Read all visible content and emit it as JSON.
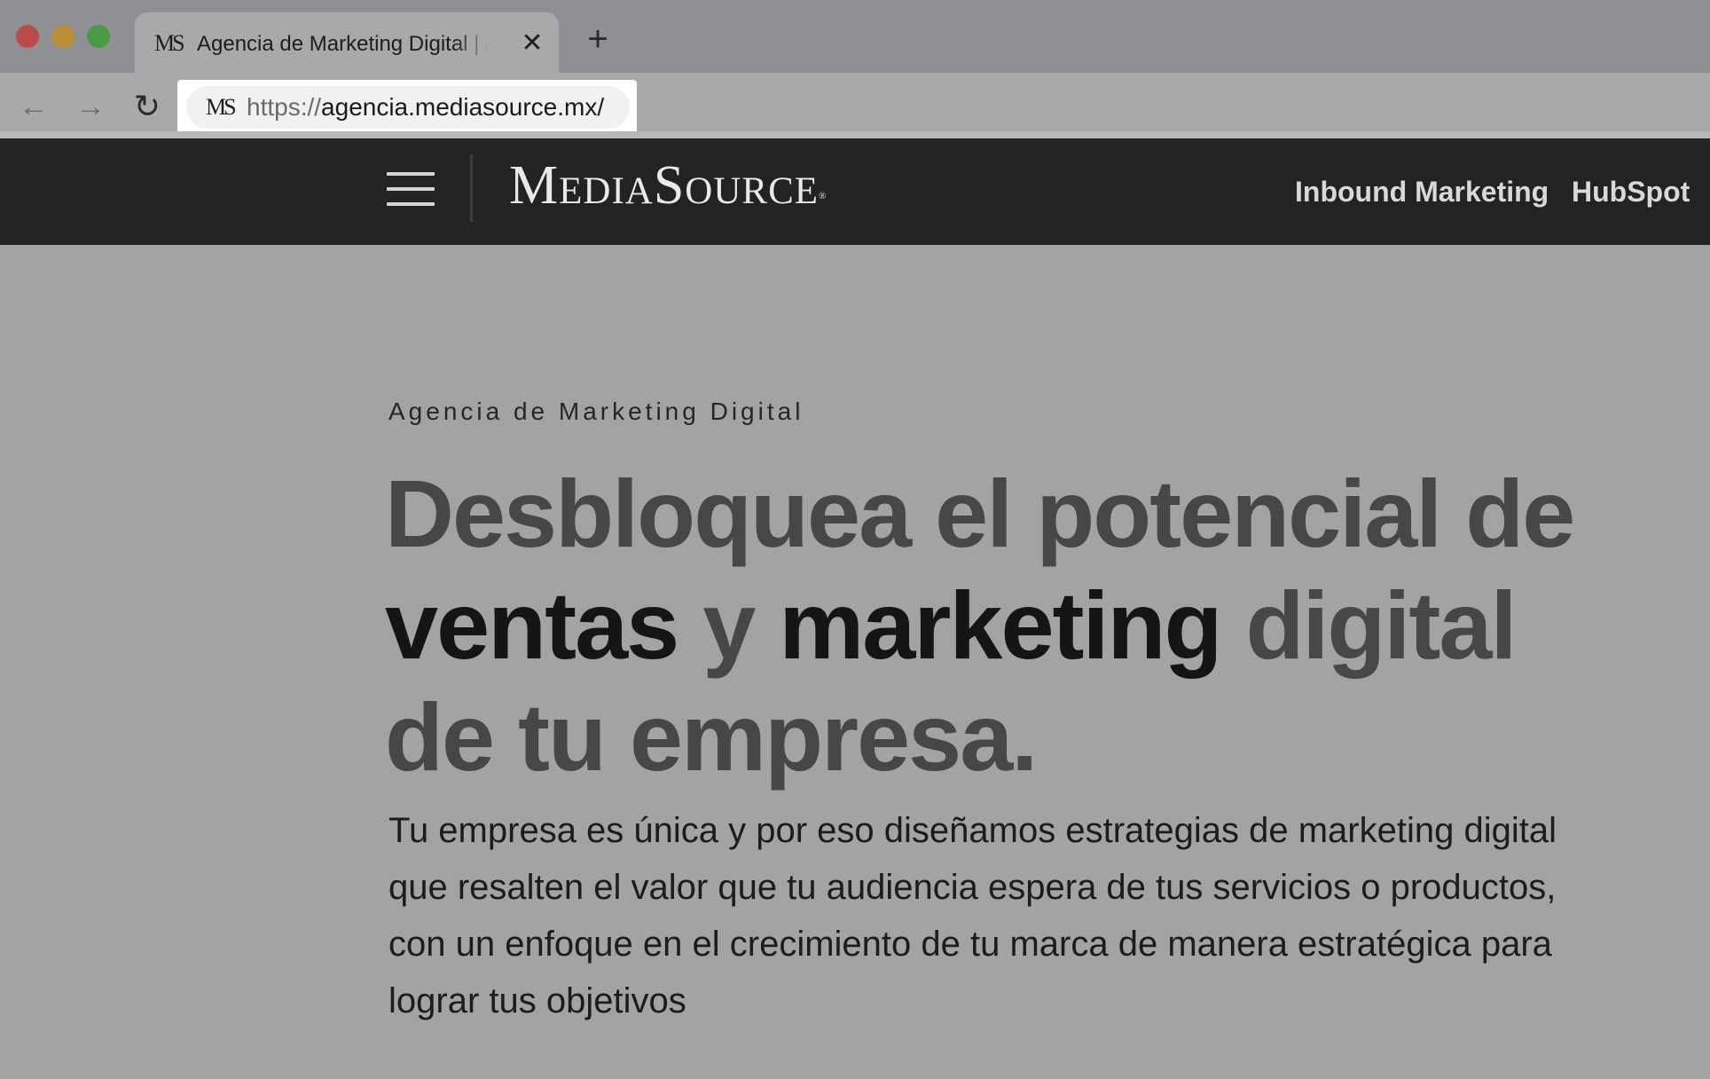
{
  "browser": {
    "tab": {
      "favicon_text": "MS",
      "title": "Agencia de Marketing Digital | Agencia MediaSource",
      "close_glyph": "✕"
    },
    "new_tab_glyph": "+",
    "nav": {
      "back_glyph": "←",
      "forward_glyph": "→",
      "reload_glyph": "↻"
    },
    "address_bar": {
      "favicon_text": "MS",
      "scheme": "https://",
      "host": "agencia.mediasource.mx/"
    }
  },
  "site": {
    "logo": "MediaSource",
    "logo_mark": "®",
    "nav_links": [
      "Inbound Marketing",
      "HubSpot"
    ]
  },
  "hero": {
    "eyebrow": "Agencia de Marketing Digital",
    "headline": {
      "part1": "Desbloquea el potencial de ",
      "highlight1": "ventas",
      "part2": " y ",
      "highlight2": "marketing",
      "part3": " digital de tu empresa."
    },
    "description": "Tu empresa es única y por eso diseñamos estrategias de marketing digital que resalten el valor que tu audiencia espera de tus servicios o productos, con un enfoque en el crecimiento de tu marca de manera estratégica para lograr tus objetivos"
  },
  "colors": {
    "header_bg": "#232324",
    "page_bg": "#a3a3a6",
    "headline_muted": "#474747",
    "headline_dark": "#151515"
  }
}
